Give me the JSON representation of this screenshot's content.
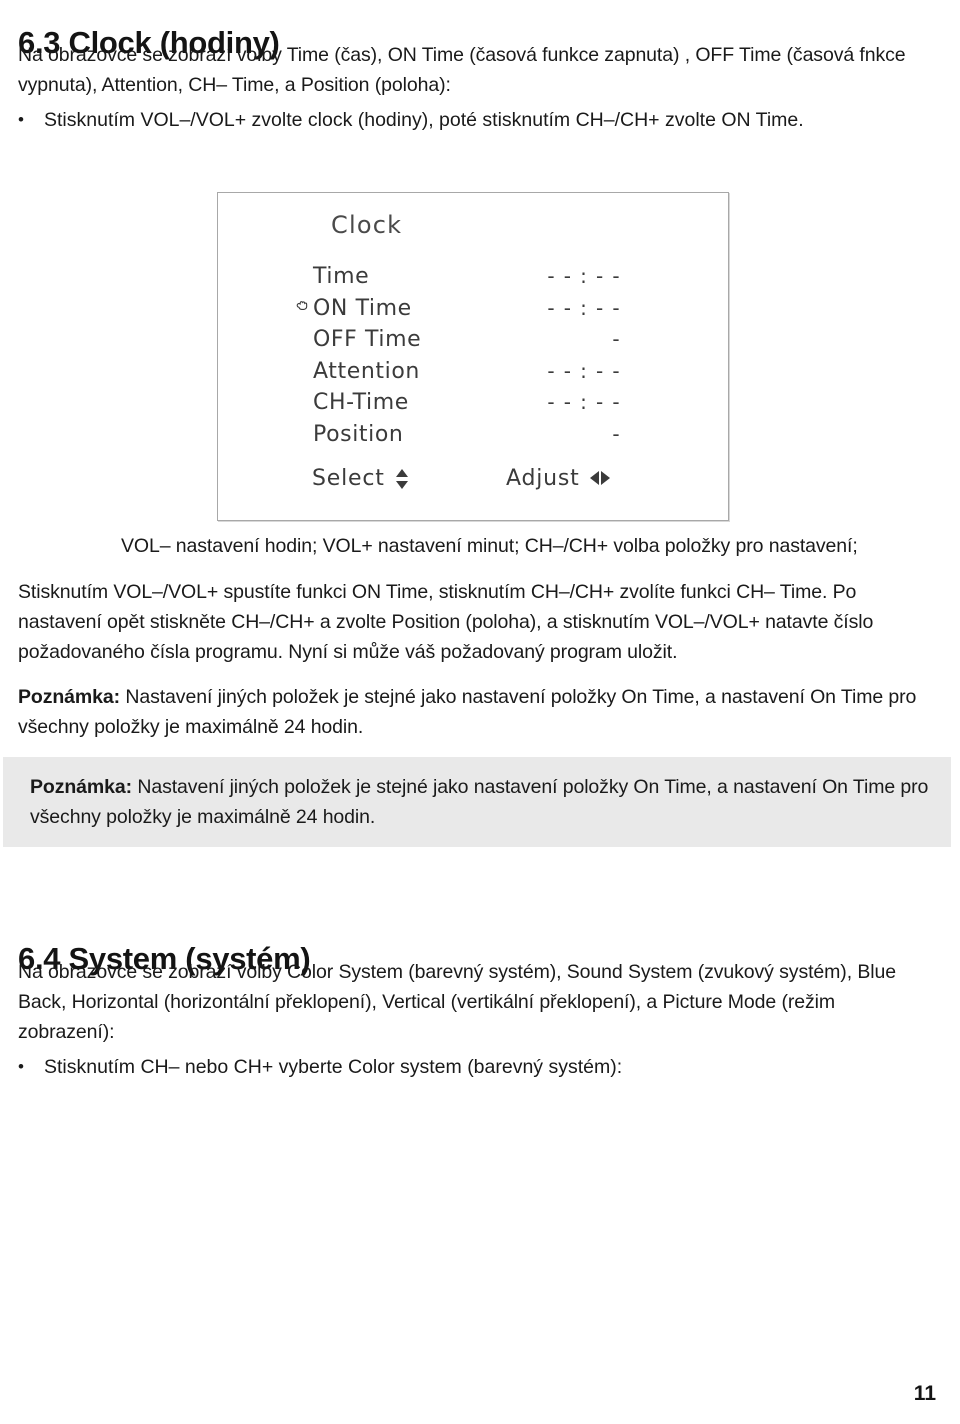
{
  "document": {
    "page_number": "11"
  },
  "section_63": {
    "heading": "6.3 Clock (hodiny)",
    "intro": "Na obrazovce se zobrazí volby Time (čas), ON Time (časová funkce zapnuta) , OFF Time (časová fnkce vypnuta), Attention, CH– Time, a Position (poloha):",
    "bullet": "Stisknutím VOL–/VOL+ zvolte clock (hodiny), poté stisknutím CH–/CH+ zvolte ON Time.",
    "caption": "VOL– nastavení hodin; VOL+ nastavení minut;   CH–/CH+ volba položky pro nastavení;",
    "paragraph": "Stisknutím VOL–/VOL+ spustíte funkci ON Time, stisknutím CH–/CH+ zvolíte funkci CH– Time. Po nastavení opět stiskněte CH–/CH+ a zvolte Position (poloha), a stisknutím VOL–/VOL+ natavte číslo požadovaného čísla programu. Nyní si může váš požadovaný program uložit.",
    "note_1": {
      "label": "Poznámka:",
      "text": " Nastavení jiných položek je stejné jako nastavení položky On Time, a nastavení On Time pro všechny položky je maximálně 24 hodin."
    },
    "note_2": {
      "label": "Poznámka:",
      "text": " Nastavení jiných položek je stejné jako nastavení položky On Time, a nastavení On Time pro všechny položky je maximálně 24 hodin.",
      "background_color": "#e9e9e9"
    }
  },
  "osd": {
    "title": "Clock",
    "cursor_icon": "pointer-hand-icon",
    "rows": [
      {
        "label": "Time",
        "value": "- - : - -",
        "cursor": false
      },
      {
        "label": "ON Time",
        "value": "- - : - -",
        "cursor": true
      },
      {
        "label": "OFF Time",
        "value": "-",
        "cursor": false
      },
      {
        "label": "Attention",
        "value": "- - : - -",
        "cursor": false
      },
      {
        "label": "CH-Time",
        "value": "- - : - -",
        "cursor": false
      },
      {
        "label": "Position",
        "value": "-",
        "cursor": false
      }
    ],
    "footer": {
      "select_label": "Select",
      "select_icon": "up-down-arrows-icon",
      "adjust_label": "Adjust",
      "adjust_icon": "left-right-arrows-icon"
    },
    "border_color": "#a8a8a8",
    "text_color": "#3b3b3b"
  },
  "section_64": {
    "heading": "6.4 System (systém)",
    "intro": "Na obrazovce se zobrazí volby Color System (barevný systém), Sound System (zvukový systém), Blue Back, Horizontal (horizontální překlopení), Vertical (vertikální překlopení), a Picture Mode (režim zobrazení):",
    "bullet": "Stisknutím CH– nebo CH+ vyberte Color system (barevný systém):"
  },
  "bullet_glyph": "•"
}
